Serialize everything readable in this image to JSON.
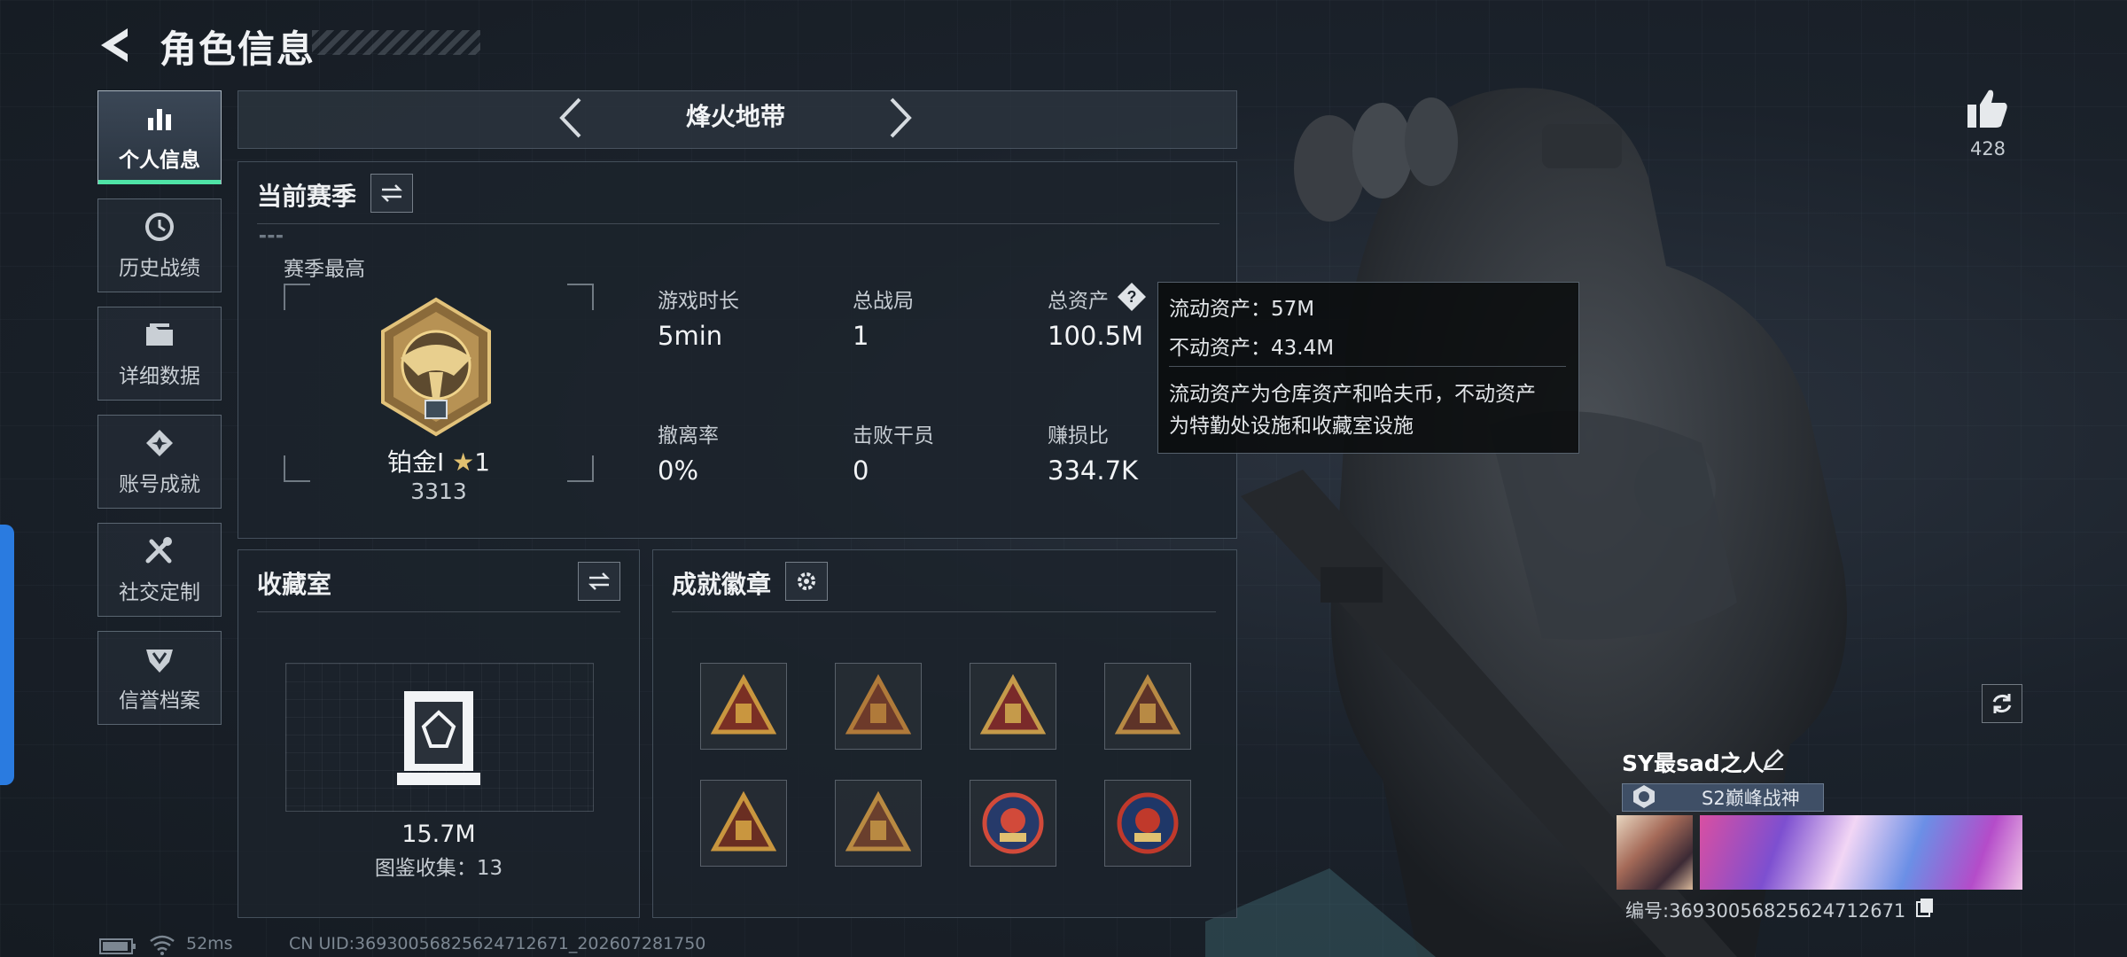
{
  "header": {
    "title": "角色信息"
  },
  "nav": [
    {
      "id": "personal",
      "label": "个人信息",
      "icon": "bar-chart-icon",
      "active": true
    },
    {
      "id": "history",
      "label": "历史战绩",
      "icon": "clock-icon"
    },
    {
      "id": "details",
      "label": "详细数据",
      "icon": "folder-icon"
    },
    {
      "id": "achievements",
      "label": "账号成就",
      "icon": "medal-icon"
    },
    {
      "id": "social",
      "label": "社交定制",
      "icon": "tools-icon"
    },
    {
      "id": "credit",
      "label": "信誉档案",
      "icon": "shield-icon"
    }
  ],
  "mode": {
    "name": "烽火地带"
  },
  "season": {
    "title": "当前赛季",
    "best_label": "赛季最高",
    "rank_name": "铂金Ⅰ",
    "rank_stars": "1",
    "rank_score": "3313",
    "stats": [
      {
        "label": "游戏时长",
        "value": "5min"
      },
      {
        "label": "总战局",
        "value": "1"
      },
      {
        "label": "总资产",
        "value": "100.5M"
      },
      {
        "label": "撤离率",
        "value": "0%"
      },
      {
        "label": "击败干员",
        "value": "0"
      },
      {
        "label": "赚损比",
        "value": "334.7K"
      }
    ]
  },
  "tooltip": {
    "liquid": "流动资产：57M",
    "fixed": "不动资产：43.4M",
    "desc1": "流动资产为仓库资产和哈夫币，不动资产",
    "desc2": "为特勤处设施和收藏室设施"
  },
  "collection": {
    "title": "收藏室",
    "value": "15.7M",
    "count_text": "图鉴收集：13"
  },
  "achievements": {
    "title": "成就徽章",
    "badges": [
      "badge-icon",
      "badge-icon",
      "badge-icon",
      "badge-icon",
      "badge-icon",
      "badge-icon",
      "badge-icon",
      "badge-icon"
    ]
  },
  "profile": {
    "likes": "428",
    "player_name": "SY最sad之人",
    "title_text": "S2巅峰战神",
    "uid_text": "编号:3693005682562471267​1"
  },
  "footer": {
    "ping": "52ms",
    "uid": "CN UID:36930056825624712671_202607281750"
  },
  "colors": {
    "accent_green": "#4fe3a6",
    "accent_blue": "#2a7be0",
    "panel_bg": "#1c232c"
  }
}
